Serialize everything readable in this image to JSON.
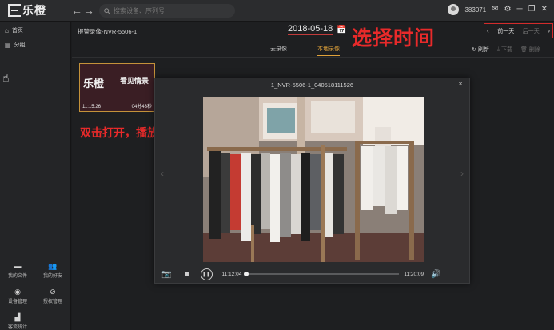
{
  "app": {
    "logo_text": "乐橙",
    "search_placeholder": "搜索设备、序列号",
    "user_id": "383071",
    "mail_icon": "mail-icon",
    "settings_icon": "gear-icon",
    "window_controls": [
      "─",
      "❐",
      "✕"
    ]
  },
  "sidebar": {
    "items": [
      {
        "label": "首页",
        "icon": "home-icon"
      },
      {
        "label": "分组",
        "icon": "folder-icon"
      }
    ],
    "bottom": [
      {
        "label": "我的文件",
        "icon": "file-icon"
      },
      {
        "label": "我的好友",
        "icon": "friends-icon"
      },
      {
        "label": "设备管理",
        "icon": "camera-icon"
      },
      {
        "label": "授权管理",
        "icon": "auth-icon"
      },
      {
        "label": "客流统计",
        "icon": "stats-icon"
      }
    ]
  },
  "main": {
    "breadcrumb": "报警录像-NVR-5506-1",
    "date": "2018-05-18",
    "annotation_select_time": "选择时间",
    "prev_day": "前一天",
    "next_day": "后一天",
    "tabs": [
      {
        "label": "云录像",
        "active": false
      },
      {
        "label": "本地录像",
        "active": true
      }
    ],
    "actions": {
      "refresh": "刷新",
      "download": "下载",
      "delete": "删除"
    },
    "thumbnail": {
      "logo_text": "乐橙",
      "logo_text2": "看见情景",
      "start_time": "11:15:26",
      "duration": "04分43秒"
    },
    "annotation_open": "双击打开，播放历史录像"
  },
  "player": {
    "title": "1_NVR-5506-1_040518111526",
    "time_start": "11:12:04",
    "time_end": "11:20:09",
    "progress": 0.0
  },
  "colors": {
    "accent": "#e0a23a",
    "annotation_red": "#e82a2a"
  }
}
